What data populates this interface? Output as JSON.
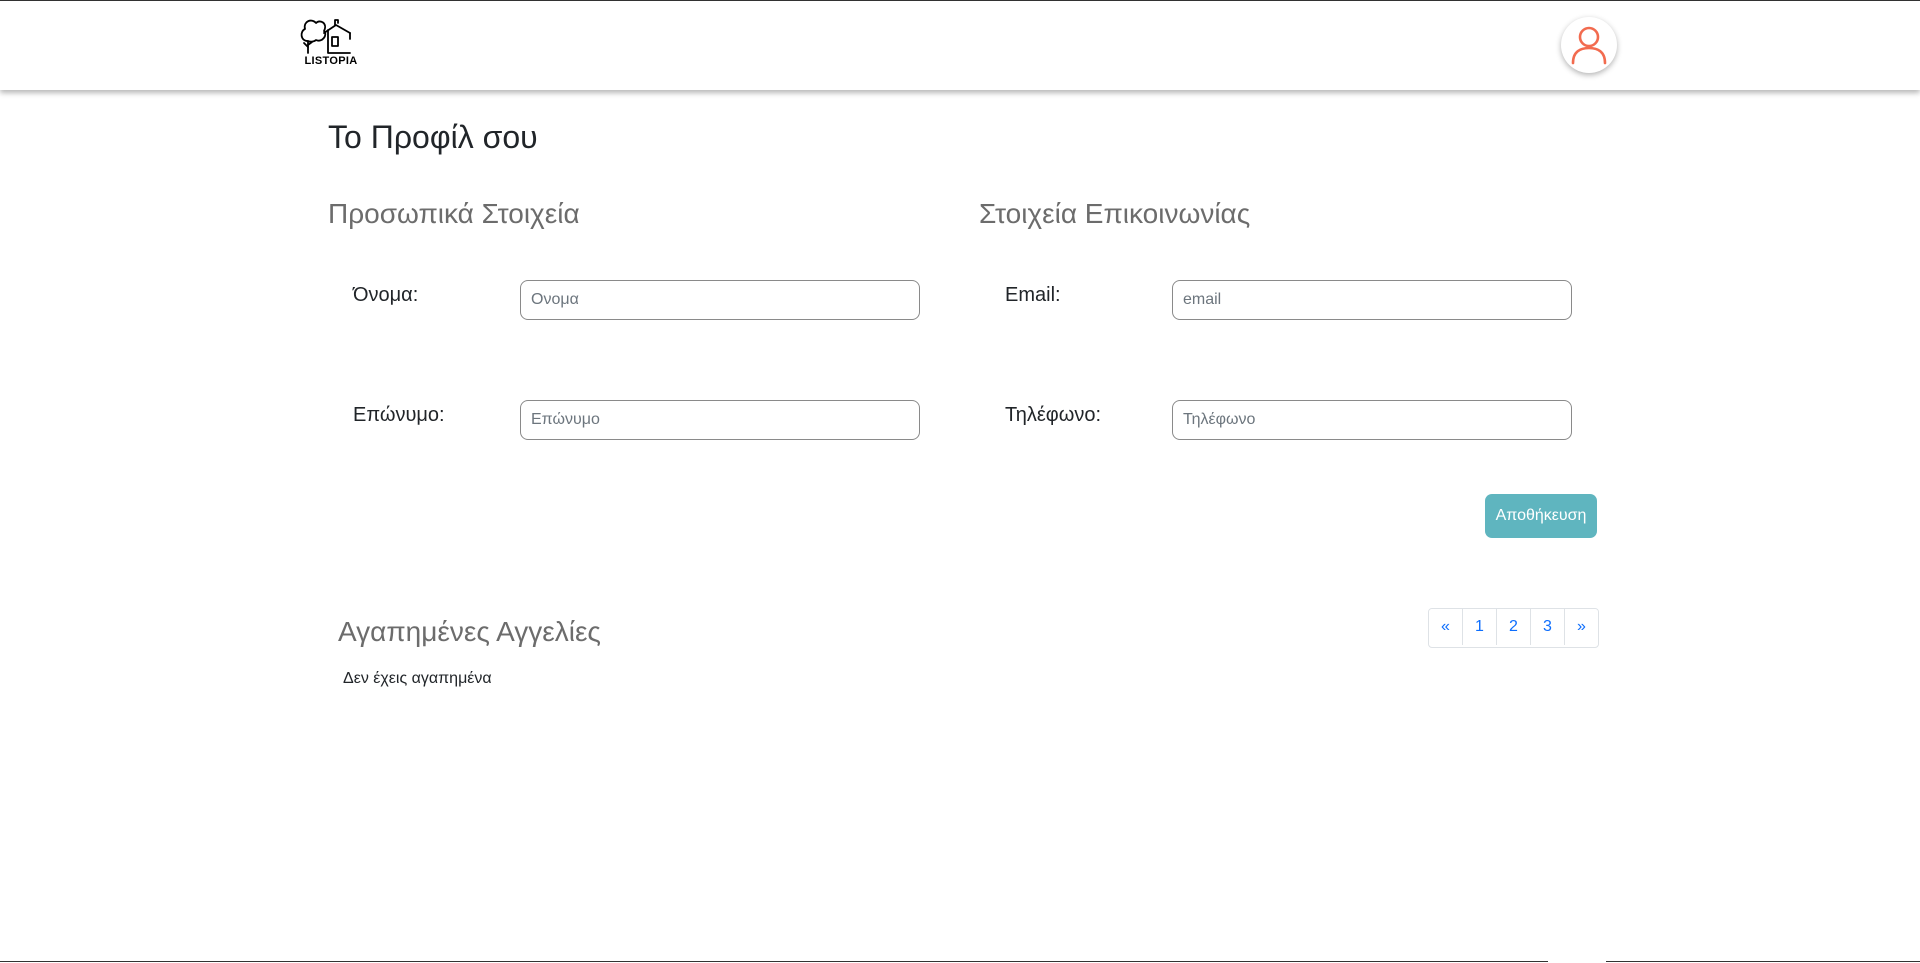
{
  "brand": {
    "logo_text": "LISTOPIA"
  },
  "header": {
    "avatar_label": "user-account"
  },
  "profile": {
    "title": "Το Προφίλ σου",
    "personal": {
      "title": "Προσωπικά Στοιχεία",
      "first_name": {
        "label": "Όνομα:",
        "placeholder": "Ονομα",
        "value": ""
      },
      "last_name": {
        "label": "Επώνυμο:",
        "placeholder": "Επώνυμο",
        "value": ""
      }
    },
    "contact": {
      "title": "Στοιχεία Επικοινωνίας",
      "email": {
        "label": "Email:",
        "placeholder": "email",
        "value": ""
      },
      "phone": {
        "label": "Τηλέφωνο:",
        "placeholder": "Τηλέφωνο",
        "value": ""
      }
    },
    "save_label": "Αποθήκευση"
  },
  "favorites": {
    "title": "Αγαπημένες Αγγελίες",
    "empty_message": "Δεν έχεις αγαπημένα",
    "pagination": {
      "prev": "«",
      "pages": [
        "1",
        "2",
        "3"
      ],
      "next": "»"
    }
  },
  "colors": {
    "accent": "#5fb5bf",
    "avatar_icon": "#f26b4f",
    "link": "#0d6efd"
  }
}
